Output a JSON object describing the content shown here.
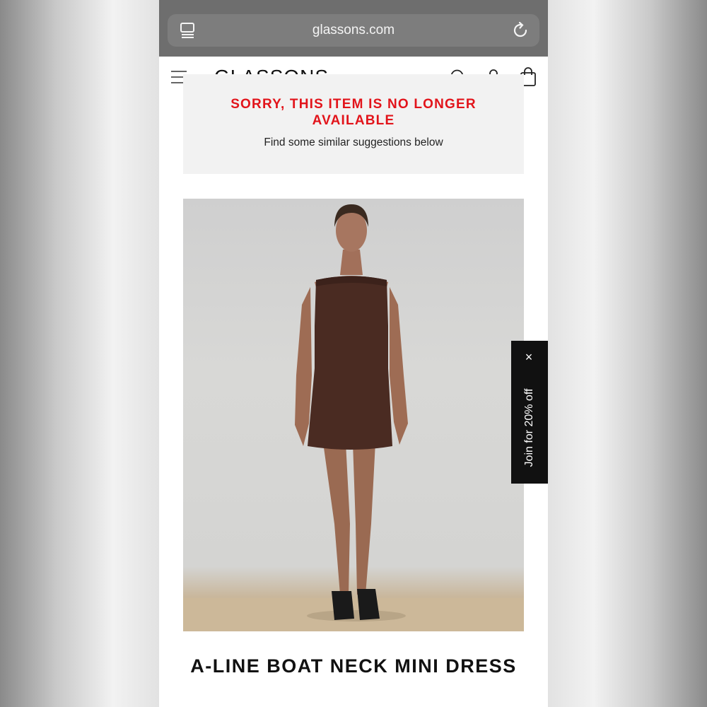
{
  "browser": {
    "url": "glassons.com"
  },
  "header": {
    "logo": "GLASSONS"
  },
  "notice": {
    "title": "SORRY, THIS ITEM IS NO LONGER AVAILABLE",
    "subtitle": "Find some similar suggestions below"
  },
  "product": {
    "title": "A-LINE BOAT NECK MINI DRESS"
  },
  "promo": {
    "label": "Join for 20% off",
    "close": "×"
  },
  "colors": {
    "alert": "#e2141b",
    "browser_chrome": "#6e6e6e",
    "promo_bg": "#111111",
    "dress": "#4a2b22"
  },
  "icons": [
    "tabs-icon",
    "reload-icon",
    "menu-icon",
    "search-icon",
    "account-icon",
    "bag-icon",
    "close-icon"
  ]
}
